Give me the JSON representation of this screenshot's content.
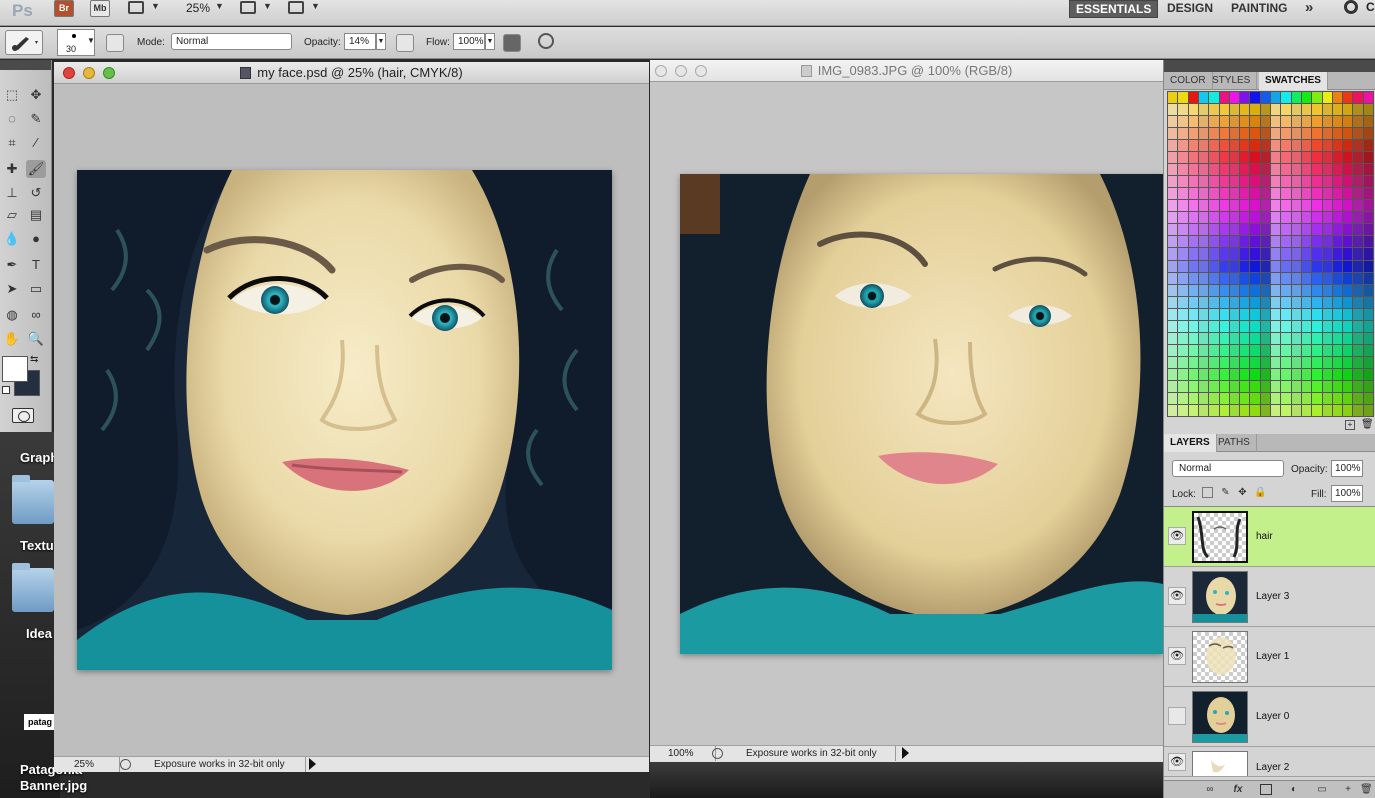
{
  "appbar": {
    "logo": "Ps",
    "bridge": "Br",
    "minibridge": "Mb",
    "zoom": "25%",
    "workspaces": [
      "ESSENTIALS",
      "DESIGN",
      "PAINTING"
    ],
    "more": "»",
    "cs_live": "C"
  },
  "options": {
    "brush_size": "30",
    "mode_label": "Mode:",
    "mode_value": "Normal",
    "opacity_label": "Opacity:",
    "opacity_value": "14%",
    "flow_label": "Flow:",
    "flow_value": "100%"
  },
  "colors": {
    "foreground": "#ffffff",
    "background": "#243040",
    "selected_layer": "#c4f08c"
  },
  "desktop": {
    "labels": [
      "Graph",
      "Textu",
      "Idea",
      "Patagonia",
      "Banner.jpg"
    ],
    "file_thumb": "patag"
  },
  "documents": [
    {
      "title": "my face.psd @ 25% (hair, CMYK/8)",
      "zoom": "25%",
      "status": "Exposure works in 32-bit only"
    },
    {
      "title": "IMG_0983.JPG @ 100% (RGB/8)",
      "zoom": "100%",
      "status": "Exposure works in 32-bit only"
    }
  ],
  "color_panel": {
    "tabs": [
      "COLOR",
      "STYLES",
      "SWATCHES"
    ],
    "active_tab": "SWATCHES"
  },
  "layers_panel": {
    "tabs": [
      "LAYERS",
      "PATHS"
    ],
    "blend_mode": "Normal",
    "opacity_label": "Opacity:",
    "opacity_value": "100%",
    "lock_label": "Lock:",
    "fill_label": "Fill:",
    "fill_value": "100%",
    "layers": [
      {
        "name": "hair",
        "visible": true,
        "selected": true
      },
      {
        "name": "Layer 3",
        "visible": true,
        "selected": false
      },
      {
        "name": "Layer 1",
        "visible": true,
        "selected": false
      },
      {
        "name": "Layer 0",
        "visible": false,
        "selected": false
      },
      {
        "name": "Layer 2",
        "visible": true,
        "selected": false
      }
    ]
  }
}
